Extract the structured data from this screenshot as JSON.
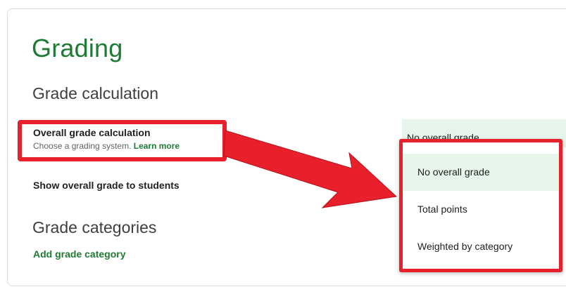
{
  "page": {
    "title": "Grading",
    "grade_calculation": {
      "heading": "Grade calculation",
      "overall": {
        "label": "Overall grade calculation",
        "description": "Choose a grading system.",
        "learn_more": "Learn more",
        "current_value": "No overall grade"
      },
      "show_to_students": {
        "label": "Show overall grade to students"
      }
    },
    "grade_categories": {
      "heading": "Grade categories",
      "add_link": "Add grade category"
    }
  },
  "dropdown": {
    "options": [
      "No overall grade",
      "Total points",
      "Weighted by category"
    ],
    "selected": "No overall grade"
  },
  "colors": {
    "accent_green": "#1e7b34",
    "selected_bg": "#e6f4ea",
    "annotation_red": "#e8202c"
  }
}
